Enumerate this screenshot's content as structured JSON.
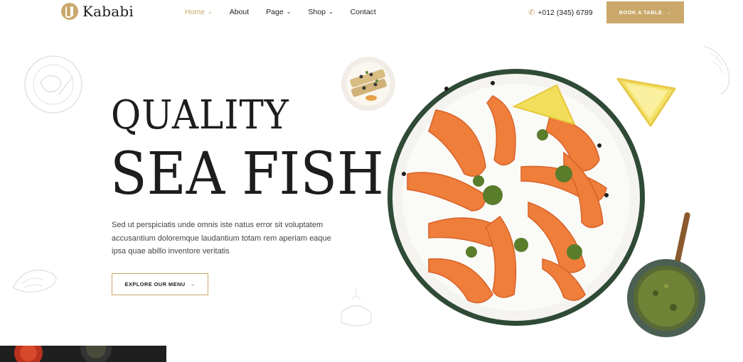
{
  "brand": {
    "name": "Kababi"
  },
  "nav": {
    "items": [
      {
        "label": "Home",
        "has_dropdown": true,
        "active": true
      },
      {
        "label": "About",
        "has_dropdown": false,
        "active": false
      },
      {
        "label": "Page",
        "has_dropdown": true,
        "active": false
      },
      {
        "label": "Shop",
        "has_dropdown": true,
        "active": false
      },
      {
        "label": "Contact",
        "has_dropdown": false,
        "active": false
      }
    ]
  },
  "header": {
    "phone": "+012 (345) 6789",
    "book_button": "BOOK A TABLE"
  },
  "hero": {
    "title_line1": "QUALITY",
    "title_line2": "SEA FISH",
    "description": "Sed ut perspiciatis unde omnis iste natus error sit voluptatem accusantium doloremque laudantium totam rem aperiam eaque ipsa quae abillo inventore veritatis",
    "cta": "EXPLORE OUR MENU"
  },
  "icons": {
    "phone": "phone-icon",
    "arrow": "arrow-right-icon",
    "chevron": "chevron-down-icon"
  },
  "colors": {
    "accent": "#c9a86a",
    "text": "#1d1d1d",
    "plate_rim": "#2f4a35"
  }
}
